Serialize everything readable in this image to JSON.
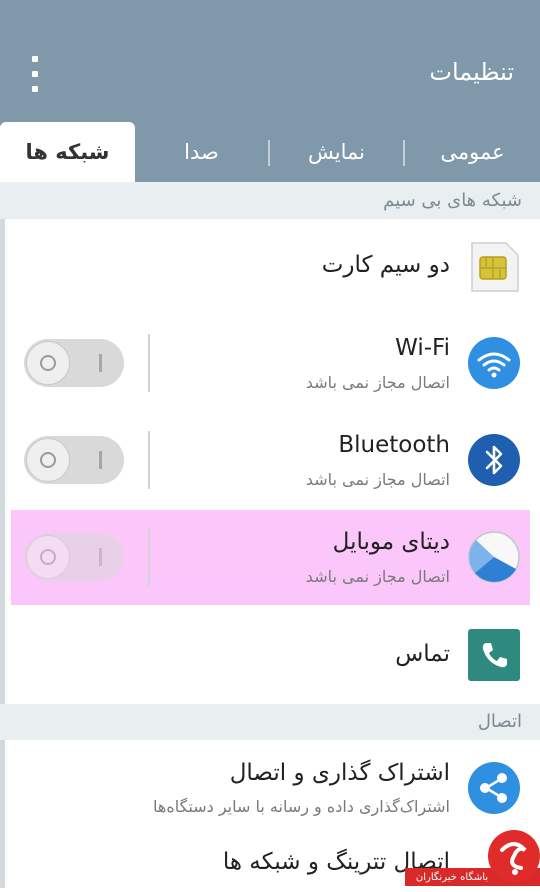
{
  "header": {
    "title": "تنظیمات"
  },
  "tabs": [
    {
      "label": "شبکه ها",
      "active": true
    },
    {
      "label": "صدا",
      "active": false
    },
    {
      "label": "نمایش",
      "active": false
    },
    {
      "label": "عمومی",
      "active": false
    }
  ],
  "sections": {
    "wireless": "شبکه های بی سیم",
    "connection": "اتصال"
  },
  "items": {
    "dual_sim": {
      "title": "دو سیم کارت",
      "icon": "sim-card-icon"
    },
    "wifi": {
      "title": "Wi-Fi",
      "subtitle": "اتصال مجاز نمی باشد",
      "icon": "wifi-icon",
      "enabled": false
    },
    "bluetooth": {
      "title": "Bluetooth",
      "subtitle": "اتصال مجاز نمی باشد",
      "icon": "bluetooth-icon",
      "enabled": false
    },
    "mobile_data": {
      "title": "دیتای موبایل",
      "subtitle": "اتصال مجاز نمی باشد",
      "icon": "data-usage-icon",
      "enabled": false
    },
    "call": {
      "title": "تماس",
      "icon": "phone-icon"
    },
    "share": {
      "title": "اشتراک گذاری و اتصال",
      "subtitle": "اشتراک‌گذاری داده و رسانه با سایر دستگاه‌ها",
      "icon": "share-icon"
    },
    "tethering": {
      "title": "اتصال تترینگ و شبکه ها"
    }
  },
  "watermark": {
    "text": "باشگاه خبرنگاران"
  },
  "colors": {
    "appbar": "#7f98aa",
    "highlight": "#fbc6f9",
    "wifi_blue": "#2f8fe0",
    "bluetooth_blue": "#1f5fb0",
    "teal": "#2e8a7f"
  }
}
